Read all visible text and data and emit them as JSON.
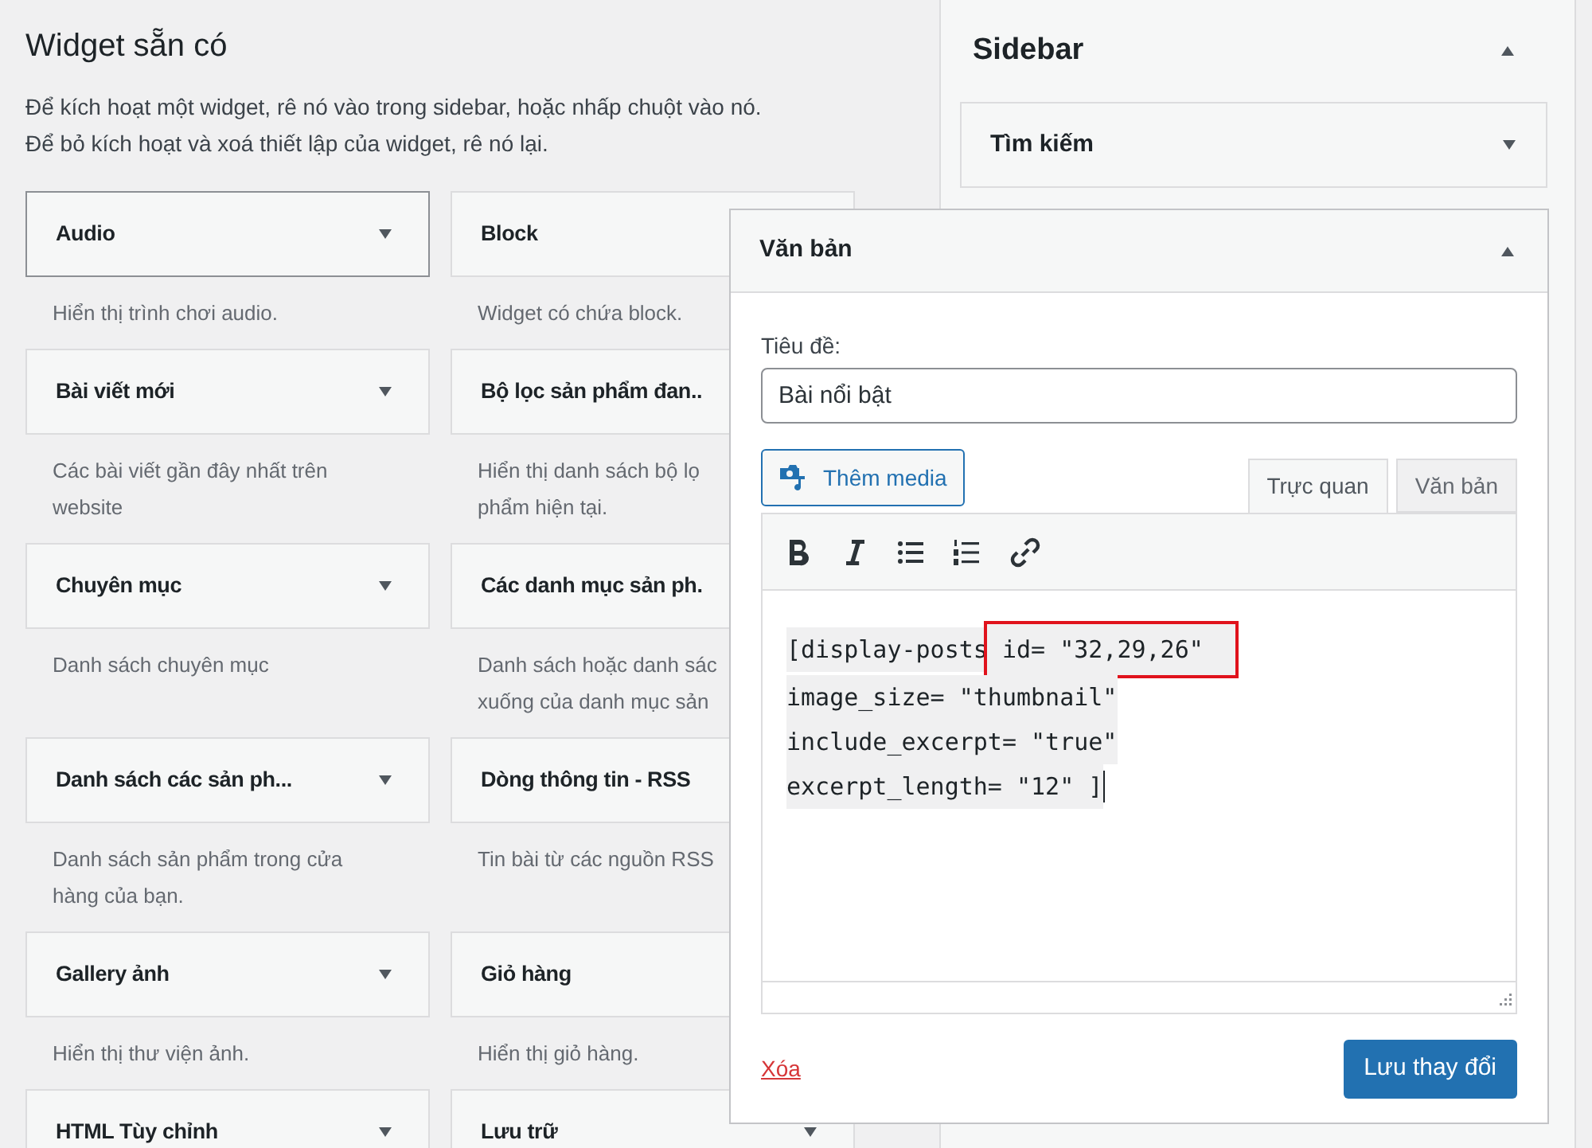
{
  "available": {
    "title": "Widget sẵn có",
    "intro": [
      "Để kích hoạt một widget, rê nó vào trong sidebar, hoặc nhấp chuột vào nó.",
      "Để bỏ kích hoạt và xoá thiết lập của widget, rê nó lại."
    ],
    "widgets": [
      {
        "name": "Audio",
        "caret": true,
        "focused": true,
        "desc": [
          "Hiển thị trình chơi audio."
        ]
      },
      {
        "name": "Block",
        "focused": false,
        "desc": [
          "Widget có chứa block."
        ]
      },
      {
        "name": "Bài viết mới",
        "caret": true,
        "focused": false,
        "desc": [
          "Các bài viết gần đây nhất trên",
          "website"
        ]
      },
      {
        "name": "Bộ lọc sản phẩm đan..",
        "focused": false,
        "desc": [
          "Hiển thị danh sách bộ lọ",
          "phẩm hiện tại."
        ]
      },
      {
        "name": "Chuyên mục",
        "caret": true,
        "focused": false,
        "desc": [
          "Danh sách chuyên mục"
        ]
      },
      {
        "name": "Các danh mục sản ph.",
        "focused": false,
        "desc": [
          "Danh sách hoặc danh sác",
          "xuống của danh mục sản"
        ]
      },
      {
        "name": "Danh sách các sản ph...",
        "caret": true,
        "focused": false,
        "desc": [
          "Danh sách sản phẩm trong cửa",
          "hàng của bạn."
        ]
      },
      {
        "name": "Dòng thông tin - RSS",
        "focused": false,
        "desc": [
          "Tin bài từ các nguồn RSS"
        ]
      },
      {
        "name": "Gallery ảnh",
        "caret": true,
        "focused": false,
        "desc": [
          "Hiển thị thư viện ảnh."
        ]
      },
      {
        "name": "Giỏ hàng",
        "focused": false,
        "desc": [
          "Hiển thị giỏ hàng."
        ]
      },
      {
        "name": "HTML Tùy chỉnh",
        "caret": true,
        "focused": false
      },
      {
        "name": "Lưu trữ",
        "caret": true,
        "focused": false
      }
    ]
  },
  "sidebar": {
    "title": "Sidebar",
    "widgets": [
      {
        "name": "Tìm kiếm"
      }
    ]
  },
  "dragged_widget": {
    "title": "Văn bản",
    "title_label": "Tiêu đề:",
    "title_value": "Bài nổi bật",
    "add_media": "Thêm media",
    "tabs": [
      {
        "label": "Trực quan",
        "selected": true
      },
      {
        "label": "Văn bản",
        "selected": false
      }
    ],
    "code": [
      {
        "parts": [
          {
            "text": "[display-posts",
            "boxed": false
          },
          {
            "text": " id= \"32,29,26\"",
            "boxed": true
          }
        ]
      },
      {
        "parts": [
          {
            "text": "image_size= \"thumbnail\"",
            "boxed": false
          }
        ]
      },
      {
        "parts": [
          {
            "text": "include_excerpt= \"true\"",
            "boxed": false
          }
        ]
      },
      {
        "parts": [
          {
            "text": "excerpt_length= \"12\" ]",
            "boxed": false
          }
        ]
      }
    ],
    "delete": "Xóa",
    "save": "Lưu thay đổi"
  }
}
